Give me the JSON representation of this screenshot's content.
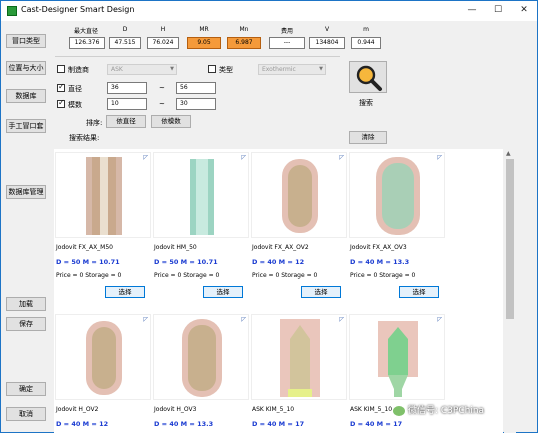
{
  "window": {
    "title": "Cast-Designer Smart Design",
    "minimize": "—",
    "maximize": "☐",
    "close": "✕"
  },
  "sidebar": {
    "riser_type": "冒口类型",
    "position_size": "位置与大小",
    "database": "数据库",
    "manual_sleeve": "手工冒口套",
    "db_manage": "数据库管理",
    "load": "加载",
    "save": "保存",
    "ok": "确定",
    "cancel": "取消"
  },
  "stats": {
    "headers": [
      "最大直径",
      "D",
      "H",
      "MR",
      "Mn",
      "费用",
      "V",
      "m"
    ],
    "values": [
      "126.376",
      "47.515",
      "76.024",
      "9.05",
      "6.987",
      "---",
      "134804",
      "0.944"
    ]
  },
  "filters": {
    "manufacturer_label": "制造商",
    "manufacturer_value": "ASK",
    "type_label": "类型",
    "type_value": "Exothermic",
    "diameter_label": "直径",
    "diameter_min": "36",
    "diameter_max": "56",
    "modulus_label": "模数",
    "modulus_min": "10",
    "modulus_max": "30",
    "tilde": "~",
    "sort_label": "排序:",
    "sort_by_diameter": "依直径",
    "sort_by_modulus": "依模数",
    "results_label": "搜索结果:",
    "clear": "清除",
    "search": "搜索"
  },
  "results": [
    {
      "name": "Jodovit FX_AX_M50",
      "dm": "D = 50     M = 10.71",
      "ps": "Price = 0 Storage = 0",
      "select": "选择"
    },
    {
      "name": "Jodovit HM_50",
      "dm": "D = 50     M = 10.71",
      "ps": "Price = 0 Storage = 0",
      "select": "选择"
    },
    {
      "name": "Jodovit FX_AX_OV2",
      "dm": "D = 40     M = 12",
      "ps": "Price = 0 Storage = 0",
      "select": "选择"
    },
    {
      "name": "Jodovit FX_AX_OV3",
      "dm": "D = 40     M = 13.3",
      "ps": "Price = 0 Storage = 0",
      "select": "选择"
    },
    {
      "name": "Jodovit H_OV2",
      "dm": "D = 40     M = 12"
    },
    {
      "name": "Jodovit H_OV3",
      "dm": "D = 40     M = 13.3"
    },
    {
      "name": "ASK KIM_5_10",
      "dm": "D = 40     M = 17"
    },
    {
      "name": "ASK KIM_5_10",
      "dm": "D = 40     M = 17"
    }
  ],
  "watermark": "微信号: C3PChina",
  "colors": {
    "highlight": "#f59a3a",
    "accent_blue": "#1a3bd1",
    "select_border": "#0078d7"
  }
}
